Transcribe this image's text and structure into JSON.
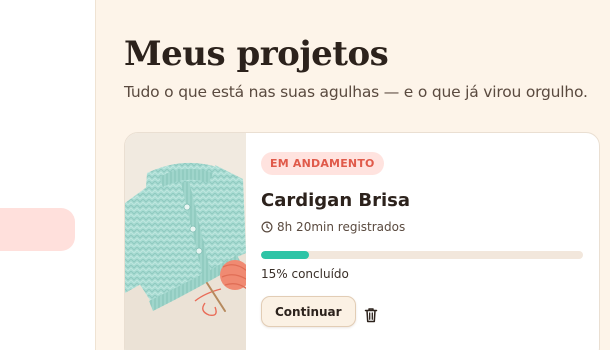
{
  "page": {
    "title": "Meus projetos",
    "subtitle": "Tudo o que está nas suas agulhas — e o que já virou orgulho."
  },
  "project": {
    "status": "EM ANDAMENTO",
    "name": "Cardigan Brisa",
    "time_logged": "8h 20min registrados",
    "progress_fraction": 0.15,
    "progress_label": "15% concluído",
    "continue_label": "Continuar",
    "image_icon": "mint-knit-cardigan-photo",
    "clock_icon": "clock-icon",
    "delete_icon": "trash-icon"
  },
  "colors": {
    "background": "#fdf4e9",
    "accent_progress": "#2ec4a6",
    "status_badge_bg": "#ffe3df",
    "status_badge_text": "#e05a4a",
    "sidebar_active": "#ffe0dc"
  }
}
